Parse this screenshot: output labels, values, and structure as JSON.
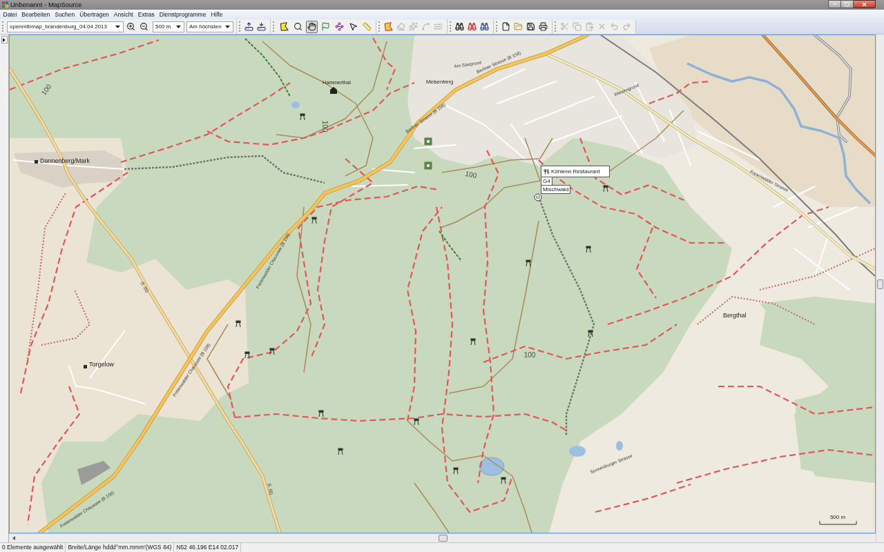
{
  "window": {
    "title": "Unbenannt - MapSource"
  },
  "menu": [
    "Datei",
    "Bearbeiten",
    "Suchen",
    "Übertragen",
    "Ansicht",
    "Extras",
    "Dienstprogramme",
    "Hilfe"
  ],
  "toolbar": {
    "map_product": "openmtbmap_brandenburg_04.04.2013",
    "zoom_scale": "500 m",
    "detail_level": "Am höchsten",
    "zoom_buttons": [
      {
        "disabled": false
      },
      {
        "disabled": false
      }
    ],
    "transfer_buttons": [
      {
        "disabled": false
      },
      {
        "disabled": false
      }
    ],
    "tools": [
      {
        "selected": false
      },
      {
        "selected": false
      },
      {
        "selected": true
      },
      {
        "selected": false
      },
      {
        "selected": false
      },
      {
        "selected": false
      },
      {
        "selected": false
      }
    ],
    "map_tools": [
      {
        "disabled": false
      },
      {
        "disabled": true
      },
      {
        "disabled": true
      },
      {
        "disabled": true
      },
      {
        "disabled": true
      }
    ],
    "find_buttons": [
      {
        "disabled": false
      },
      {
        "disabled": false
      },
      {
        "disabled": false
      }
    ],
    "file_buttons": [
      {
        "disabled": false
      },
      {
        "disabled": false
      },
      {
        "disabled": false
      },
      {
        "disabled": false
      }
    ],
    "edit_buttons": [
      {
        "disabled": true
      },
      {
        "disabled": true
      },
      {
        "disabled": true
      },
      {
        "disabled": true
      },
      {
        "disabled": true
      },
      {
        "disabled": true
      }
    ]
  },
  "map": {
    "places": [
      "Dannenberg/Mark",
      "Torgelow",
      "Bergthal",
      "Hammerthal",
      "Meisenberg"
    ],
    "street_labels": [
      "Am Saugrund",
      "Wiesengrund",
      "Berliner Strasse (B 158)",
      "Berliner Strasse (B 158)",
      "Freienwalder Chaussee (B 158)",
      "Freienwalder Chaussee (B 158)",
      "Freienwalder Chaussee (B 158)",
      "(L 35)",
      "(L 35)",
      "Freienwalder Strasse",
      "Sonnenburger Strasse"
    ],
    "contour_labels": [
      "100",
      "100",
      "100",
      "100"
    ],
    "poi_popup": {
      "name": "Köhlerei Restaurant",
      "details": [
        "G4",
        "Mischwald"
      ]
    },
    "scale": "500 m"
  },
  "status_bar": [
    "0 Elemente ausgewählt",
    "Breite/Länge hddd°mm.mmm'(WGS 84)",
    "N52 46.196 E14 02.017"
  ]
}
